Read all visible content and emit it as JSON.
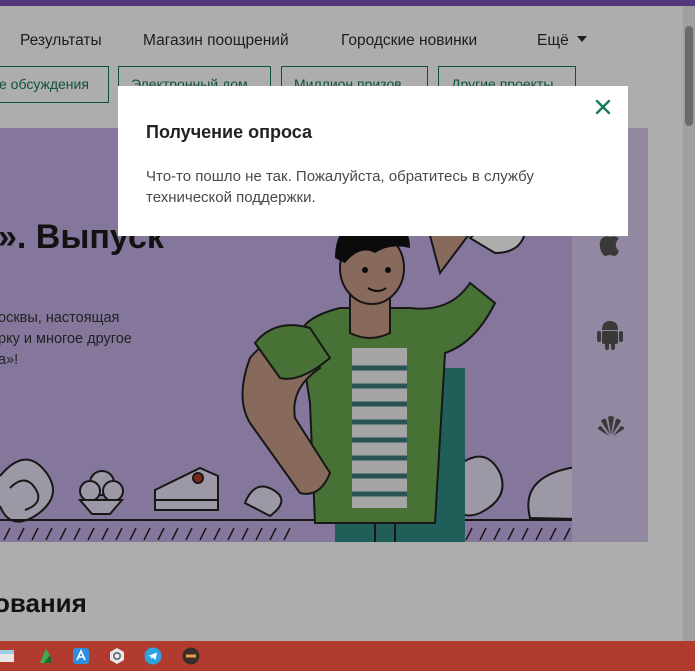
{
  "nav": {
    "items": [
      {
        "label": "Результаты"
      },
      {
        "label": "Магазин поощрений"
      },
      {
        "label": "Городские новинки"
      },
      {
        "label": "Ещё"
      }
    ]
  },
  "pills": [
    {
      "label": "е обсуждения"
    },
    {
      "label": "Электронный дом"
    },
    {
      "label": "Миллион призов"
    },
    {
      "label": "Другие проекты"
    }
  ],
  "banner": {
    "title": "». Выпуск",
    "desc_lines": [
      "осквы, настоящая",
      "рку и многое другое",
      "а»!"
    ]
  },
  "section_heading": "ования",
  "modal": {
    "title": "Получение опроса",
    "message": "Что-то пошло не так. Пожалуйста, обратитесь в службу технической поддержки."
  },
  "icons": {
    "close": "close-icon",
    "apple": "apple-icon",
    "android": "android-icon",
    "huawei": "huawei-icon"
  },
  "colors": {
    "accent": "#157a5c",
    "topbar": "#7b53b8",
    "banner_bg": "#c4aee6",
    "taskbar": "#b23b30"
  }
}
